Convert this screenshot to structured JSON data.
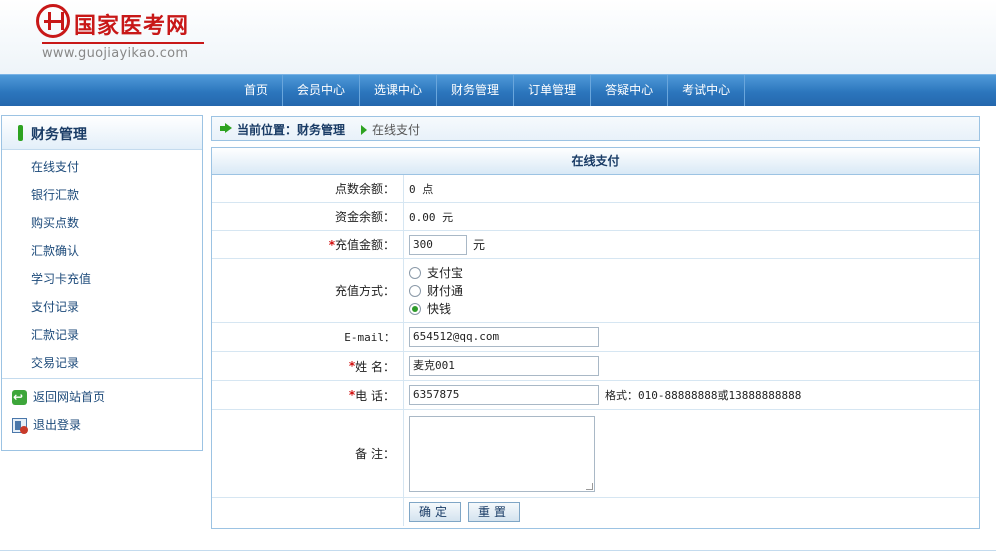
{
  "header": {
    "logo_title": "国家医考网",
    "logo_url": "www.guojiayikao.com"
  },
  "nav": {
    "items": [
      "首页",
      "会员中心",
      "选课中心",
      "财务管理",
      "订单管理",
      "答疑中心",
      "考试中心"
    ]
  },
  "sidebar": {
    "title": "财务管理",
    "items": [
      "在线支付",
      "银行汇款",
      "购买点数",
      "汇款确认",
      "学习卡充值",
      "支付记录",
      "汇款记录",
      "交易记录"
    ],
    "links": [
      "返回网站首页",
      "退出登录"
    ]
  },
  "breadcrumb": {
    "prefix": "当前位置：财务管理",
    "current": "在线支付"
  },
  "form": {
    "title": "在线支付",
    "points_label": "点数余额：",
    "points_value": "0 点",
    "funds_label": "资金余额：",
    "funds_value": "0.00 元",
    "amount_label": "充值金额：",
    "amount_value": "300",
    "amount_unit": "元",
    "method_label": "充值方式：",
    "methods": [
      "支付宝",
      "财付通",
      "快钱"
    ],
    "selected_method": "快钱",
    "email_label": "E-mail：",
    "email_value": "654512@qq.com",
    "name_label": "姓 名：",
    "name_value": "麦克001",
    "phone_label": "电 话：",
    "phone_value": "6357875",
    "phone_hint": "格式：010-88888888或13888888888",
    "remark_label": "备 注：",
    "remark_value": "",
    "submit_label": "确定",
    "reset_label": "重置",
    "required_mark": "*"
  },
  "colors": {
    "nav_blue": "#2c76bd",
    "accent_green": "#2ea321",
    "required_red": "#d21010",
    "border_blue": "#9cc3e3"
  }
}
